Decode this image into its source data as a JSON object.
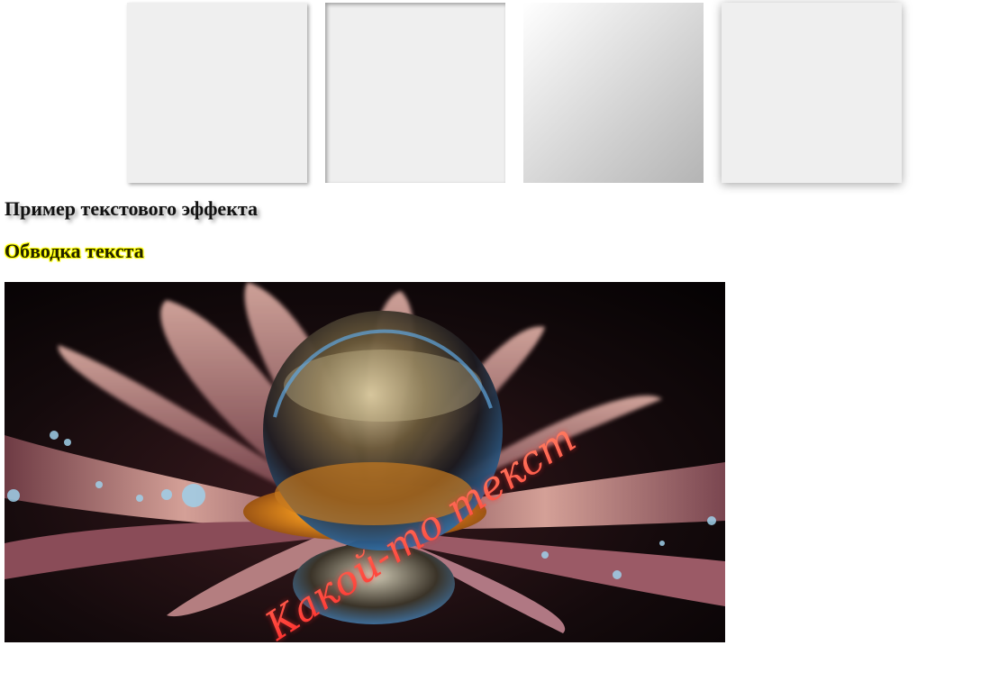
{
  "boxes": [
    {
      "name": "outer-shadow-box",
      "effect": "outer shadow"
    },
    {
      "name": "inner-shadow-box",
      "effect": "inset shadow"
    },
    {
      "name": "gradient-box",
      "effect": "linear gradient"
    },
    {
      "name": "glow-shadow-box",
      "effect": "blur shadow"
    }
  ],
  "text_effect_heading": "Пример текстового эффекта",
  "outline_text": "Обводка текста",
  "image": {
    "overlay_text": "Какой-то текст",
    "colors": {
      "background": "#0b0607",
      "petal": "#c98f8a",
      "center": "#d9821a",
      "overlay_text": "#ff4a3a"
    }
  }
}
